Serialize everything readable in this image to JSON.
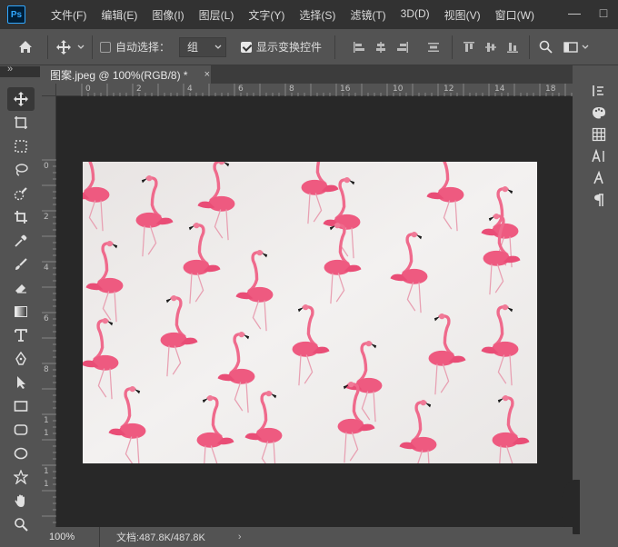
{
  "app": {
    "logo": "Ps"
  },
  "menu": [
    "文件(F)",
    "编辑(E)",
    "图像(I)",
    "图层(L)",
    "文字(Y)",
    "选择(S)",
    "滤镜(T)",
    "3D(D)",
    "视图(V)",
    "窗口(W)"
  ],
  "window_controls": {
    "minimize": "—",
    "maximize": "□"
  },
  "options": {
    "auto_select_label": "自动选择：",
    "auto_select_checked": false,
    "auto_select_target": "组",
    "show_transform_label": "显示变换控件",
    "show_transform_checked": true
  },
  "panel_collapse": {
    "left": "»",
    "right": "«"
  },
  "document_tab": {
    "title": "图案.jpeg @ 100%(RGB/8) *",
    "close": "×"
  },
  "ruler_top": [
    "0",
    "2",
    "4",
    "6",
    "8",
    "10",
    "12",
    "14",
    "16",
    "18"
  ],
  "ruler_left": [
    "0",
    "2",
    "4",
    "6",
    "8",
    "1",
    "1",
    "1",
    "1"
  ],
  "status": {
    "zoom": "100%",
    "doc_info": "文档:487.8K/487.8K",
    "arrow": "›"
  },
  "tools": [
    "move-tool",
    "artboard-tool",
    "marquee-tool",
    "lasso-tool",
    "quick-select-tool",
    "crop-tool",
    "eyedropper-tool",
    "brush-tool",
    "eraser-tool",
    "gradient-tool",
    "type-tool",
    "pen-tool",
    "path-select-tool",
    "rectangle-tool",
    "rounded-rectangle-tool",
    "ellipse-tool",
    "custom-shape-tool",
    "hand-tool",
    "zoom-tool"
  ],
  "right_panel_icons": [
    "history-icon",
    "color-palette-icon",
    "swatches-grid-icon",
    "character-icon",
    "glyphs-icon",
    "paragraph-icon"
  ],
  "colors": {
    "menubar": "#323232",
    "ui": "#535353",
    "canvas_bg": "#282828",
    "ps_blue": "#31a8ff",
    "flamingo": "#ef5f85"
  }
}
